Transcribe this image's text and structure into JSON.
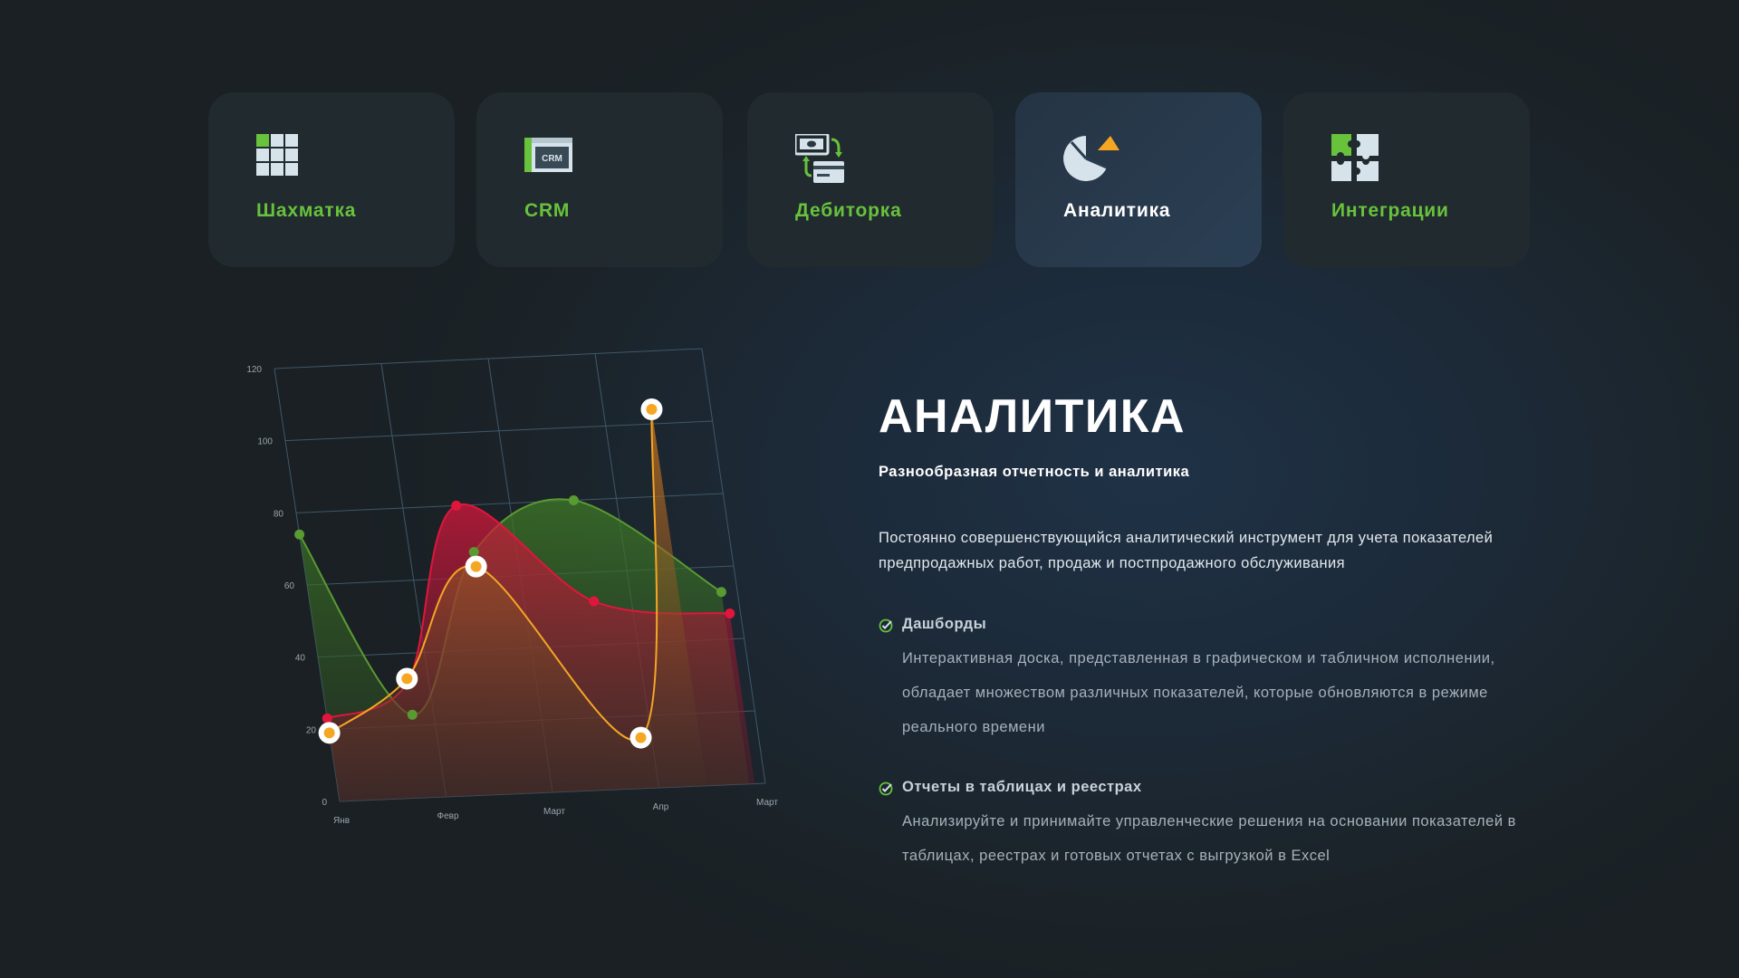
{
  "tabs": [
    {
      "label": "Шахматка",
      "icon": "grid-icon",
      "active": false
    },
    {
      "label": "CRM",
      "icon": "crm-window-icon",
      "icon_text": "CRM",
      "active": false
    },
    {
      "label": "Дебиторка",
      "icon": "money-transfer-icon",
      "active": false
    },
    {
      "label": "Аналитика",
      "icon": "pie-chart-icon",
      "active": true
    },
    {
      "label": "Интеграции",
      "icon": "puzzle-icon",
      "active": false
    }
  ],
  "colors": {
    "accent_green": "#68c23c",
    "icon_light": "#d6e3ea",
    "series_green": "#5a9a32",
    "series_red": "#e0163c",
    "series_orange": "#f5a623"
  },
  "main": {
    "title": "АНАЛИТИКА",
    "subtitle": "Разнообразная отчетность и аналитика",
    "description": "Постоянно совершенствующийся аналитический инструмент для учета показателей предпродажных работ, продаж и постпродажного обслуживания",
    "features": [
      {
        "title": "Дашборды",
        "text": "Интерактивная доска, представленная в графическом и табличном исполнении, обладает множеством различных показателей, которые обновляются в режиме реального времени"
      },
      {
        "title": "Отчеты в таблицах и реестрах",
        "text": "Анализируйте и принимайте управленческие решения на основании показателей в таблицах, реестрах и готовых отчетах с выгрузкой в Excel"
      }
    ]
  },
  "chart_data": {
    "type": "area",
    "categories": [
      "Янв",
      "Февр",
      "Март",
      "Апр",
      "Март"
    ],
    "y_ticks": [
      0,
      20,
      40,
      60,
      80,
      100,
      120
    ],
    "ylim": [
      0,
      120
    ],
    "grid": true,
    "perspective": "3d-tilted",
    "series": [
      {
        "color": "#5a9a32",
        "x": [
          0,
          0.8,
          1.6,
          2.6,
          3.85
        ],
        "values": [
          74,
          23,
          67,
          80,
          53
        ]
      },
      {
        "color": "#e0163c",
        "x": [
          0,
          0.8,
          1.5,
          2.65,
          3.9
        ],
        "values": [
          23,
          32,
          80,
          52,
          47
        ]
      },
      {
        "color": "#f5a623",
        "x": [
          0,
          0.8,
          1.6,
          2.9,
          3.45
        ],
        "values": [
          19,
          33,
          63,
          14,
          104
        ]
      }
    ]
  }
}
